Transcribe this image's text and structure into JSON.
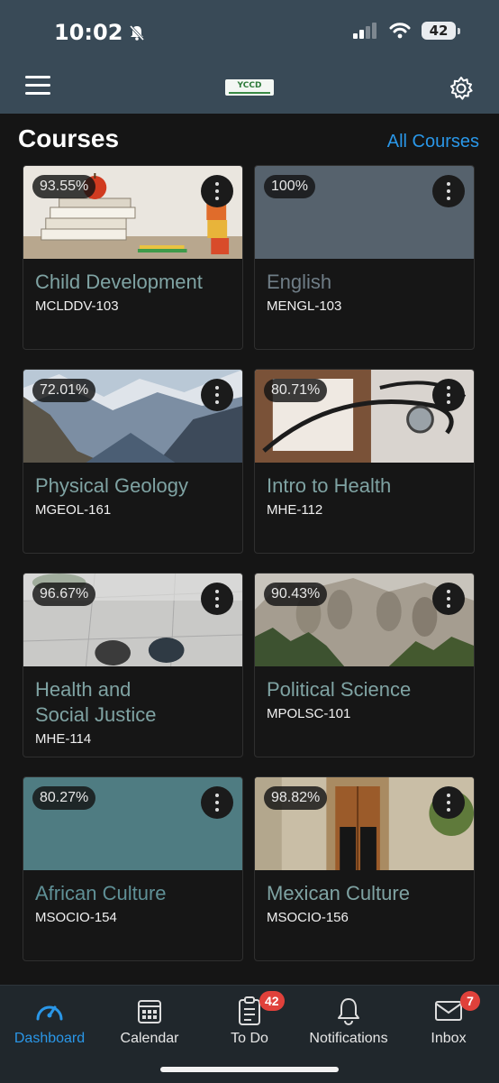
{
  "status": {
    "time": "10:02",
    "battery": "42"
  },
  "header": {
    "logo_text": "YCCD"
  },
  "courses_section": {
    "title": "Courses",
    "all_courses_label": "All Courses"
  },
  "courses": [
    {
      "grade": "93.55%",
      "name": "Child Development",
      "code": "MCLDDV-103",
      "image": "books-apple-blocks"
    },
    {
      "grade": "100%",
      "name": "English",
      "code": "MENGL-103",
      "image": "solid-slate",
      "color": "#56626d"
    },
    {
      "grade": "72.01%",
      "name": "Physical Geology",
      "code": "MGEOL-161",
      "image": "mountains"
    },
    {
      "grade": "80.71%",
      "name": "Intro to Health",
      "code": "MHE-112",
      "image": "stethoscope"
    },
    {
      "grade": "96.67%",
      "name": "Health and Social Justice",
      "code": "MHE-114",
      "image": "passion-led-us-here"
    },
    {
      "grade": "90.43%",
      "name": "Political Science",
      "code": "MPOLSC-101",
      "image": "mount-rushmore"
    },
    {
      "grade": "80.27%",
      "name": "African Culture",
      "code": "MSOCIO-154",
      "image": "solid-teal",
      "color": "#4f7c82"
    },
    {
      "grade": "98.82%",
      "name": "Mexican Culture",
      "code": "MSOCIO-156",
      "image": "wooden-door"
    }
  ],
  "tabs": [
    {
      "label": "Dashboard",
      "icon": "dashboard-gauge-icon",
      "active": true
    },
    {
      "label": "Calendar",
      "icon": "calendar-icon"
    },
    {
      "label": "To Do",
      "icon": "todo-clipboard-icon",
      "badge": "42"
    },
    {
      "label": "Notifications",
      "icon": "bell-icon"
    },
    {
      "label": "Inbox",
      "icon": "envelope-icon",
      "badge": "7"
    }
  ],
  "colors": {
    "accent": "#2a97e8",
    "header": "#394a57",
    "course_name": "#7fa3a3",
    "badge": "#e0413b"
  }
}
